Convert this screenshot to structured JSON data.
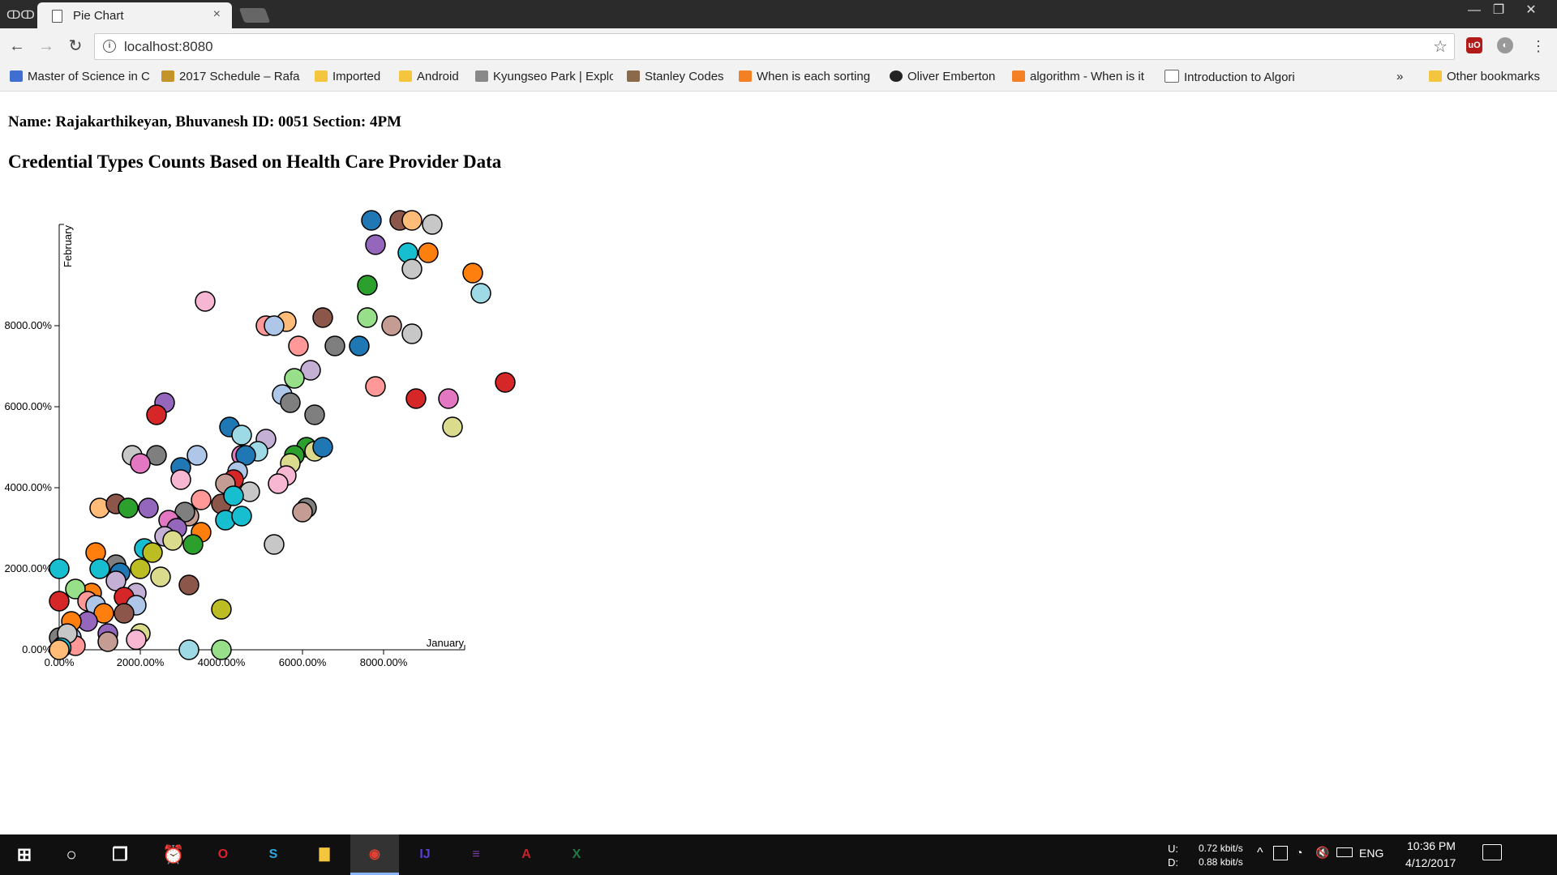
{
  "browser": {
    "tab_title": "Pie Chart",
    "tab_close": "×",
    "url": "localhost:8080",
    "window_controls": [
      "—",
      "❐",
      "✕"
    ],
    "nav": {
      "back": "←",
      "forward": "→",
      "reload": "↻"
    },
    "bookmarks": [
      {
        "label": "Master of Science in C",
        "icon": "graduation-icon",
        "color": "#3f6fd1"
      },
      {
        "label": "2017 Schedule – Rafa",
        "icon": "tennis-icon",
        "color": "#c4942b"
      },
      {
        "label": "Imported",
        "icon": "folder-icon",
        "color": "#f4c63d"
      },
      {
        "label": "Android",
        "icon": "folder-icon",
        "color": "#f4c63d"
      },
      {
        "label": "Kyungseo Park | Explo",
        "icon": "site-icon",
        "color": "#888888"
      },
      {
        "label": "Stanley Codes",
        "icon": "avatar-icon",
        "color": "#8a6a4a"
      },
      {
        "label": "When is each sorting",
        "icon": "stack-icon",
        "color": "#f48024"
      },
      {
        "label": "Oliver Emberton",
        "icon": "circle-logo-icon",
        "color": "#222222"
      },
      {
        "label": "algorithm - When is it",
        "icon": "stack-icon",
        "color": "#f48024"
      },
      {
        "label": "Introduction to Algori",
        "icon": "page-icon",
        "color": "#ffffff"
      }
    ],
    "overflow": "»",
    "other_bookmarks": "Other bookmarks"
  },
  "page": {
    "name_line": "Name: Rajakarthikeyan, Bhuvanesh ID: 0051 Section: 4PM",
    "chart_title": "Credential Types Counts Based on Health Care Provider Data"
  },
  "chart_data": {
    "type": "scatter",
    "title": "Credential Types Counts Based on Health Care Provider Data",
    "xlabel": "January",
    "ylabel": "February",
    "x_ticks": [
      "0.00%",
      "2000.00%",
      "4000.00%",
      "6000.00%",
      "8000.00%"
    ],
    "y_ticks": [
      "0.00%",
      "2000.00%",
      "4000.00%",
      "6000.00%",
      "8000.00%"
    ],
    "xlim": [
      0,
      10000
    ],
    "ylim": [
      0,
      10000
    ],
    "grid": false,
    "points": [
      {
        "x": 7700,
        "y": 10600,
        "c": "#1f77b4"
      },
      {
        "x": 8400,
        "y": 10600,
        "c": "#8c564b"
      },
      {
        "x": 8700,
        "y": 10600,
        "c": "#ffbb78"
      },
      {
        "x": 9200,
        "y": 10500,
        "c": "#c7c7c7"
      },
      {
        "x": 7800,
        "y": 10000,
        "c": "#9467bd"
      },
      {
        "x": 8600,
        "y": 9800,
        "c": "#17becf"
      },
      {
        "x": 9100,
        "y": 9800,
        "c": "#ff7f0e"
      },
      {
        "x": 8700,
        "y": 9400,
        "c": "#c7c7c7"
      },
      {
        "x": 10200,
        "y": 9300,
        "c": "#ff7f0e"
      },
      {
        "x": 7600,
        "y": 9000,
        "c": "#2ca02c"
      },
      {
        "x": 10400,
        "y": 8800,
        "c": "#9edae5"
      },
      {
        "x": 3600,
        "y": 8600,
        "c": "#f7b6d2"
      },
      {
        "x": 6500,
        "y": 8200,
        "c": "#8c564b"
      },
      {
        "x": 7600,
        "y": 8200,
        "c": "#98df8a"
      },
      {
        "x": 5600,
        "y": 8100,
        "c": "#ffbb78"
      },
      {
        "x": 5100,
        "y": 8000,
        "c": "#ff9896"
      },
      {
        "x": 5300,
        "y": 8000,
        "c": "#aec7e8"
      },
      {
        "x": 8200,
        "y": 8000,
        "c": "#c49c94"
      },
      {
        "x": 8700,
        "y": 7800,
        "c": "#c7c7c7"
      },
      {
        "x": 6800,
        "y": 7500,
        "c": "#7f7f7f"
      },
      {
        "x": 7400,
        "y": 7500,
        "c": "#1f77b4"
      },
      {
        "x": 5900,
        "y": 7500,
        "c": "#ff9896"
      },
      {
        "x": 6200,
        "y": 6900,
        "c": "#c5b0d5"
      },
      {
        "x": 5800,
        "y": 6700,
        "c": "#98df8a"
      },
      {
        "x": 7800,
        "y": 6500,
        "c": "#ff9896"
      },
      {
        "x": 11000,
        "y": 6600,
        "c": "#d62728"
      },
      {
        "x": 8800,
        "y": 6200,
        "c": "#d62728"
      },
      {
        "x": 9600,
        "y": 6200,
        "c": "#e377c2"
      },
      {
        "x": 5500,
        "y": 6300,
        "c": "#aec7e8"
      },
      {
        "x": 5700,
        "y": 6100,
        "c": "#7f7f7f"
      },
      {
        "x": 2600,
        "y": 6100,
        "c": "#9467bd"
      },
      {
        "x": 2400,
        "y": 5800,
        "c": "#d62728"
      },
      {
        "x": 6300,
        "y": 5800,
        "c": "#7f7f7f"
      },
      {
        "x": 9700,
        "y": 5500,
        "c": "#dbdb8d"
      },
      {
        "x": 4200,
        "y": 5500,
        "c": "#1f77b4"
      },
      {
        "x": 4500,
        "y": 5300,
        "c": "#9edae5"
      },
      {
        "x": 5100,
        "y": 5200,
        "c": "#c5b0d5"
      },
      {
        "x": 6100,
        "y": 5000,
        "c": "#2ca02c"
      },
      {
        "x": 6300,
        "y": 4900,
        "c": "#dbdb8d"
      },
      {
        "x": 6500,
        "y": 5000,
        "c": "#1f77b4"
      },
      {
        "x": 4900,
        "y": 4900,
        "c": "#9edae5"
      },
      {
        "x": 4500,
        "y": 4800,
        "c": "#e377c2"
      },
      {
        "x": 4600,
        "y": 4800,
        "c": "#1f77b4"
      },
      {
        "x": 5800,
        "y": 4800,
        "c": "#2ca02c"
      },
      {
        "x": 5700,
        "y": 4600,
        "c": "#dbdb8d"
      },
      {
        "x": 1800,
        "y": 4800,
        "c": "#c7c7c7"
      },
      {
        "x": 2400,
        "y": 4800,
        "c": "#7f7f7f"
      },
      {
        "x": 3400,
        "y": 4800,
        "c": "#aec7e8"
      },
      {
        "x": 2000,
        "y": 4600,
        "c": "#e377c2"
      },
      {
        "x": 3000,
        "y": 4500,
        "c": "#1f77b4"
      },
      {
        "x": 4400,
        "y": 4400,
        "c": "#aec7e8"
      },
      {
        "x": 5600,
        "y": 4300,
        "c": "#f7b6d2"
      },
      {
        "x": 5400,
        "y": 4100,
        "c": "#f7b6d2"
      },
      {
        "x": 4300,
        "y": 4200,
        "c": "#d62728"
      },
      {
        "x": 4100,
        "y": 4100,
        "c": "#c49c94"
      },
      {
        "x": 4700,
        "y": 3900,
        "c": "#c7c7c7"
      },
      {
        "x": 3000,
        "y": 4200,
        "c": "#f7b6d2"
      },
      {
        "x": 1000,
        "y": 3500,
        "c": "#ffbb78"
      },
      {
        "x": 1400,
        "y": 3600,
        "c": "#8c564b"
      },
      {
        "x": 1700,
        "y": 3500,
        "c": "#2ca02c"
      },
      {
        "x": 2200,
        "y": 3500,
        "c": "#9467bd"
      },
      {
        "x": 4000,
        "y": 3600,
        "c": "#8c564b"
      },
      {
        "x": 4300,
        "y": 3800,
        "c": "#17becf"
      },
      {
        "x": 6100,
        "y": 3500,
        "c": "#7f7f7f"
      },
      {
        "x": 6000,
        "y": 3400,
        "c": "#c49c94"
      },
      {
        "x": 3500,
        "y": 3700,
        "c": "#ff9896"
      },
      {
        "x": 3200,
        "y": 3300,
        "c": "#c49c94"
      },
      {
        "x": 3100,
        "y": 3400,
        "c": "#7f7f7f"
      },
      {
        "x": 2800,
        "y": 3100,
        "c": "#17becf"
      },
      {
        "x": 2700,
        "y": 3200,
        "c": "#e377c2"
      },
      {
        "x": 2900,
        "y": 3000,
        "c": "#9467bd"
      },
      {
        "x": 3500,
        "y": 2900,
        "c": "#ff7f0e"
      },
      {
        "x": 4100,
        "y": 3200,
        "c": "#17becf"
      },
      {
        "x": 4500,
        "y": 3300,
        "c": "#17becf"
      },
      {
        "x": 2600,
        "y": 2800,
        "c": "#c5b0d5"
      },
      {
        "x": 2800,
        "y": 2700,
        "c": "#dbdb8d"
      },
      {
        "x": 3300,
        "y": 2600,
        "c": "#2ca02c"
      },
      {
        "x": 5300,
        "y": 2600,
        "c": "#c7c7c7"
      },
      {
        "x": 900,
        "y": 2400,
        "c": "#ff7f0e"
      },
      {
        "x": 2100,
        "y": 2500,
        "c": "#17becf"
      },
      {
        "x": 2300,
        "y": 2400,
        "c": "#bcbd22"
      },
      {
        "x": 1400,
        "y": 2100,
        "c": "#7f7f7f"
      },
      {
        "x": 1000,
        "y": 2000,
        "c": "#17becf"
      },
      {
        "x": 1500,
        "y": 1900,
        "c": "#1f77b4"
      },
      {
        "x": 2000,
        "y": 2000,
        "c": "#bcbd22"
      },
      {
        "x": 2500,
        "y": 1800,
        "c": "#dbdb8d"
      },
      {
        "x": 3200,
        "y": 1600,
        "c": "#8c564b"
      },
      {
        "x": 0,
        "y": 2000,
        "c": "#17becf"
      },
      {
        "x": 1400,
        "y": 1700,
        "c": "#c5b0d5"
      },
      {
        "x": 1900,
        "y": 1400,
        "c": "#c5b0d5"
      },
      {
        "x": 800,
        "y": 1400,
        "c": "#ff7f0e"
      },
      {
        "x": 1600,
        "y": 1300,
        "c": "#d62728"
      },
      {
        "x": 1900,
        "y": 1100,
        "c": "#aec7e8"
      },
      {
        "x": 400,
        "y": 1500,
        "c": "#98df8a"
      },
      {
        "x": 0,
        "y": 1200,
        "c": "#d62728"
      },
      {
        "x": 700,
        "y": 1200,
        "c": "#ff9896"
      },
      {
        "x": 900,
        "y": 1100,
        "c": "#aec7e8"
      },
      {
        "x": 1100,
        "y": 900,
        "c": "#ff7f0e"
      },
      {
        "x": 1600,
        "y": 900,
        "c": "#8c564b"
      },
      {
        "x": 4000,
        "y": 1000,
        "c": "#bcbd22"
      },
      {
        "x": 700,
        "y": 700,
        "c": "#9467bd"
      },
      {
        "x": 300,
        "y": 700,
        "c": "#ff7f0e"
      },
      {
        "x": 1200,
        "y": 400,
        "c": "#9467bd"
      },
      {
        "x": 2000,
        "y": 400,
        "c": "#dbdb8d"
      },
      {
        "x": 1200,
        "y": 200,
        "c": "#c49c94"
      },
      {
        "x": 1900,
        "y": 250,
        "c": "#f7b6d2"
      },
      {
        "x": 3200,
        "y": 0,
        "c": "#9edae5"
      },
      {
        "x": 4000,
        "y": 0,
        "c": "#98df8a"
      },
      {
        "x": 0,
        "y": 300,
        "c": "#7f7f7f"
      },
      {
        "x": 300,
        "y": 300,
        "c": "#aec7e8"
      },
      {
        "x": 100,
        "y": 100,
        "c": "#1f77b4"
      },
      {
        "x": 400,
        "y": 100,
        "c": "#ff9896"
      },
      {
        "x": 200,
        "y": 400,
        "c": "#c7c7c7"
      },
      {
        "x": 50,
        "y": 50,
        "c": "#17becf"
      },
      {
        "x": 0,
        "y": 0,
        "c": "#ffbb78"
      }
    ]
  },
  "taskbar": {
    "apps": [
      {
        "name": "start-icon",
        "glyph": "⊞",
        "color": "#ffffff"
      },
      {
        "name": "cortana-icon",
        "glyph": "○",
        "color": "#ffffff"
      },
      {
        "name": "task-view-icon",
        "glyph": "❐",
        "color": "#ffffff"
      },
      {
        "name": "alarm-app-icon",
        "glyph": "⏰",
        "color": "#ffffff"
      },
      {
        "name": "opera-icon",
        "glyph": "O",
        "color": "#e0202c"
      },
      {
        "name": "skype-icon",
        "glyph": "S",
        "color": "#2aa8e0"
      },
      {
        "name": "file-explorer-icon",
        "glyph": "▇",
        "color": "#f4c63d"
      },
      {
        "name": "chrome-icon",
        "glyph": "◉",
        "color": "#e34133"
      },
      {
        "name": "intellij-icon",
        "glyph": "IJ",
        "color": "#5a3fd6"
      },
      {
        "name": "winrar-icon",
        "glyph": "≡",
        "color": "#7b3fa0"
      },
      {
        "name": "acrobat-icon",
        "glyph": "A",
        "color": "#c5242a"
      },
      {
        "name": "excel-icon",
        "glyph": "X",
        "color": "#1f7a45"
      }
    ],
    "net_up_label": "U:",
    "net_down_label": "D:",
    "net_up": "0.72 kbit/s",
    "net_down": "0.88 kbit/s",
    "language": "ENG",
    "time": "10:36 PM",
    "date": "4/12/2017"
  }
}
